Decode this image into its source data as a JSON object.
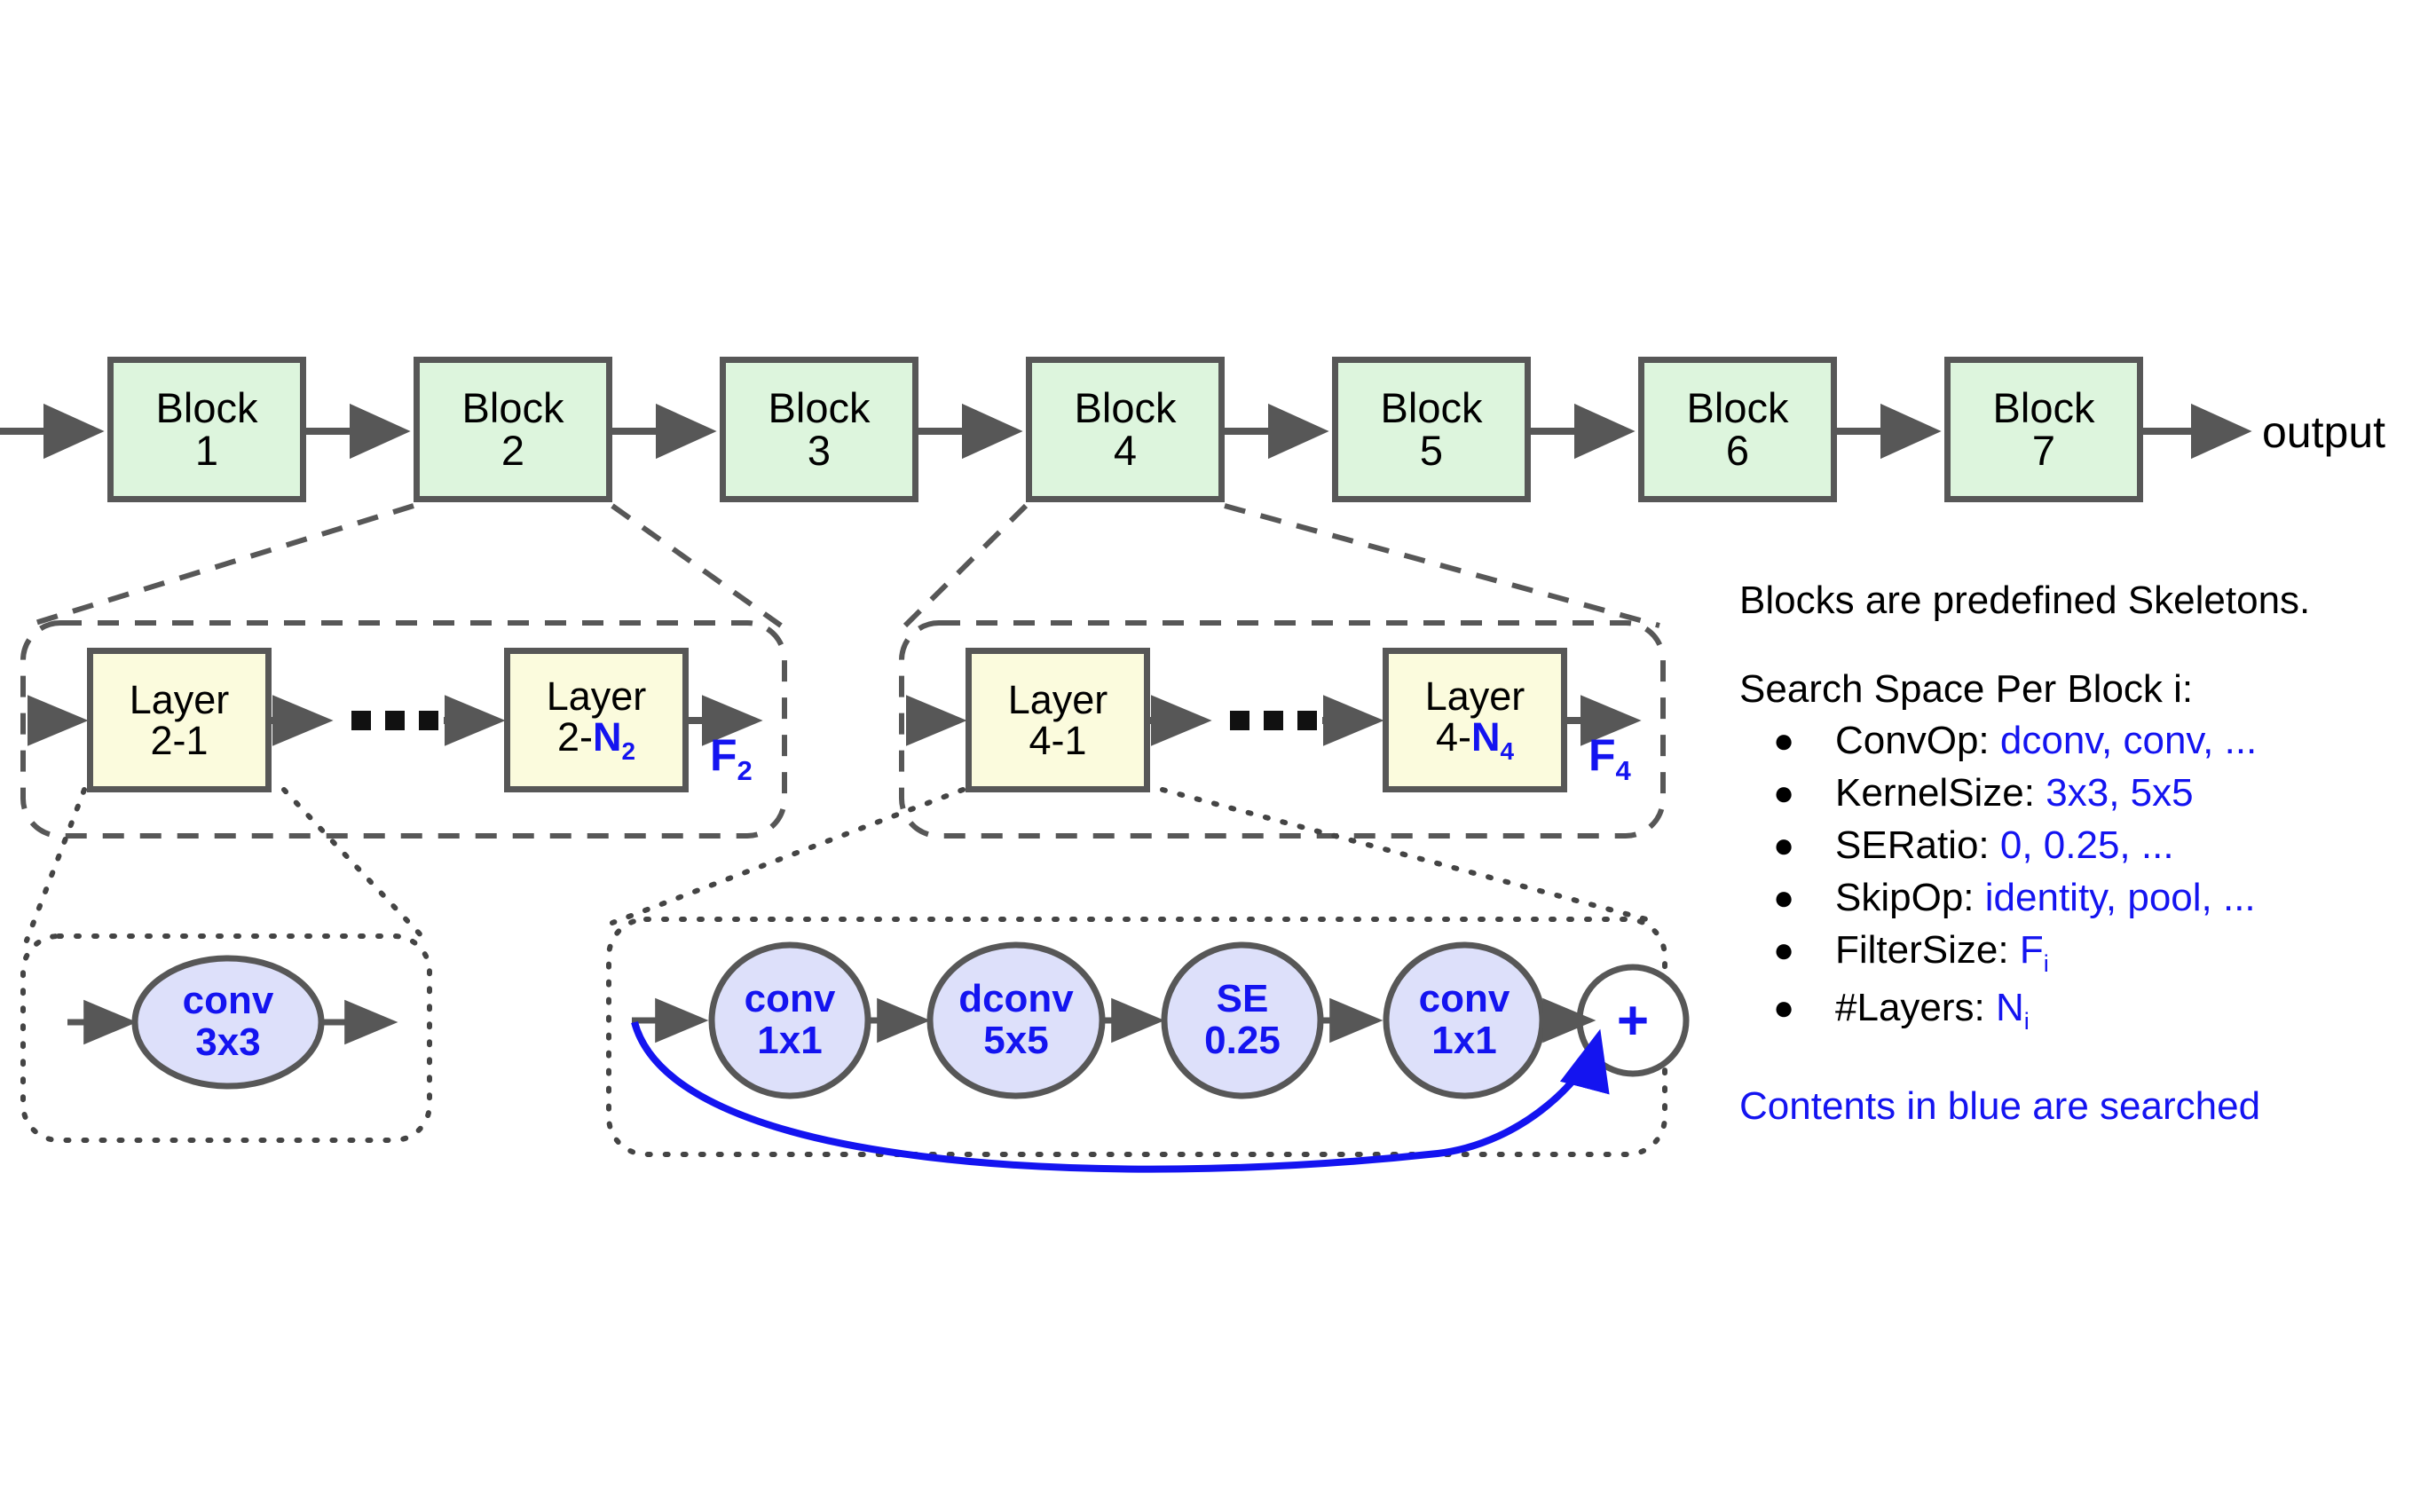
{
  "diagram": {
    "title_text": "",
    "colors": {
      "block_fill": "#ddf5dd",
      "layer_fill": "#fbfbdd",
      "op_fill": "#dde0fa",
      "stroke": "#575757",
      "accent_blue": "#1414f0"
    },
    "pipeline": {
      "output_label": "output",
      "blocks": [
        {
          "line1": "Block",
          "line2": "1"
        },
        {
          "line1": "Block",
          "line2": "2"
        },
        {
          "line1": "Block",
          "line2": "3"
        },
        {
          "line1": "Block",
          "line2": "4"
        },
        {
          "line1": "Block",
          "line2": "5"
        },
        {
          "line1": "Block",
          "line2": "6"
        },
        {
          "line1": "Block",
          "line2": "7"
        }
      ]
    },
    "block2_expansion": {
      "first_layer": {
        "line1": "Layer",
        "line2_prefix": "2-",
        "line2_value": "1"
      },
      "ellipsis": "...",
      "last_layer": {
        "line1": "Layer",
        "line2_prefix": "2-",
        "line2_value": "N",
        "line2_sub": "2"
      },
      "filter_label": {
        "base": "F",
        "sub": "2"
      }
    },
    "block4_expansion": {
      "first_layer": {
        "line1": "Layer",
        "line2_prefix": "4-",
        "line2_value": "1"
      },
      "ellipsis": "...",
      "last_layer": {
        "line1": "Layer",
        "line2_prefix": "4-",
        "line2_value": "N",
        "line2_sub": "4"
      },
      "filter_label": {
        "base": "F",
        "sub": "4"
      }
    },
    "layer2_detail": {
      "ops": [
        {
          "line1": "conv",
          "line2": "3x3"
        }
      ]
    },
    "layer4_detail": {
      "ops": [
        {
          "line1": "conv",
          "line2": "1x1"
        },
        {
          "line1": "dconv",
          "line2": "5x5"
        },
        {
          "line1": "SE",
          "line2": "0.25"
        },
        {
          "line1": "conv",
          "line2": "1x1"
        }
      ],
      "add_node": "+"
    },
    "legend": {
      "heading": "Blocks are predefined Skeletons.",
      "subheading": "Search Space Per Block i:",
      "items": [
        {
          "key": "ConvOp:",
          "value": "dconv, conv, ...",
          "sub": ""
        },
        {
          "key": "KernelSize:",
          "value": "3x3, 5x5",
          "sub": ""
        },
        {
          "key": "SERatio:",
          "value": "0, 0.25, ...",
          "sub": ""
        },
        {
          "key": "SkipOp:",
          "value": "identity, pool, ...",
          "sub": ""
        },
        {
          "key": "FilterSize:",
          "value": "F",
          "sub": "i"
        },
        {
          "key": "#Layers:",
          "value": "N",
          "sub": "i"
        }
      ],
      "footer": "Contents in blue are searched"
    }
  }
}
